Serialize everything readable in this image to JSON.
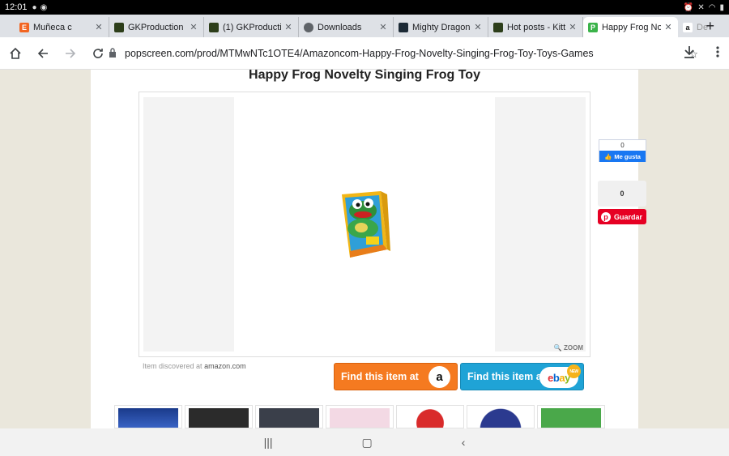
{
  "status": {
    "time": "12:01"
  },
  "tabs": [
    {
      "title": "Muñeca c",
      "fav_letter": "E",
      "fav_color": "#f26522",
      "active": false
    },
    {
      "title": "GKProduction",
      "fav_letter": "",
      "fav_color": "#2d3e1a",
      "active": false
    },
    {
      "title": "(1) GKProductio",
      "fav_letter": "",
      "fav_color": "#2d3e1a",
      "active": false
    },
    {
      "title": "Downloads",
      "fav_letter": "",
      "fav_color": "#5f6368",
      "active": false
    },
    {
      "title": "Mighty Dragon",
      "fav_letter": "",
      "fav_color": "#1c2a36",
      "active": false
    },
    {
      "title": "Hot posts - Kitt",
      "fav_letter": "",
      "fav_color": "#2d3e1a",
      "active": false
    },
    {
      "title": "Happy Frog No",
      "fav_letter": "P",
      "fav_color": "#3bb34a",
      "active": true
    },
    {
      "title": "De",
      "fav_letter": "a",
      "fav_color": "#ffffff",
      "active": false
    }
  ],
  "toolbar": {
    "url": "popscreen.com/prod/MTMwNTc1OTE4/Amazoncom-Happy-Frog-Novelty-Singing-Frog-Toy-Toys-Games"
  },
  "page": {
    "title": "Happy Frog Novelty Singing Frog Toy",
    "zoom_label": "ZOOM",
    "discovered_prefix": "Item discovered at",
    "discovered_source": "amazon.com",
    "amazon_button": "Find this item at",
    "ebay_button": "Find this item at",
    "ebay_logo": "ebay",
    "new_badge": "NEW"
  },
  "social": {
    "fb_count": "0",
    "fb_like": "Me gusta",
    "pin_count": "0",
    "pin_save": "Guardar"
  },
  "thumbs": [
    {
      "bg": "#1a3a8a"
    },
    {
      "bg": "#2b2b2b"
    },
    {
      "bg": "#3a3f4a"
    },
    {
      "bg": "#f3d9e4"
    },
    {
      "bg": "#d92b2b"
    },
    {
      "bg": "#2b3a8f"
    },
    {
      "bg": "#4aa84a"
    }
  ]
}
